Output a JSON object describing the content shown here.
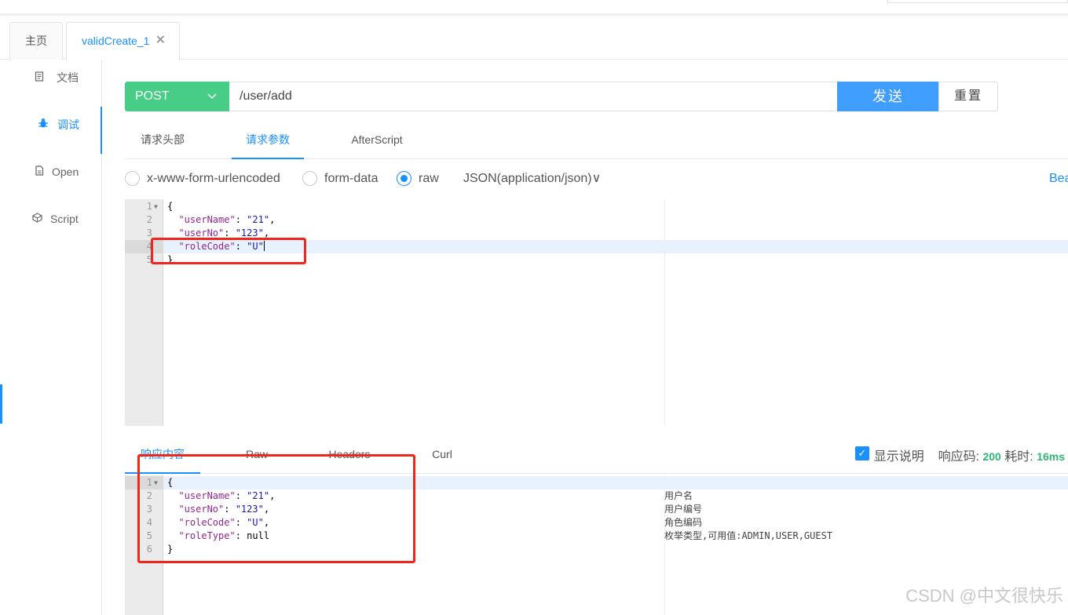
{
  "tabs": {
    "home": "主页",
    "active": "validCreate_1",
    "close_glyph": "✕"
  },
  "sidebar": {
    "items": [
      {
        "label": "文档",
        "icon": "document-icon"
      },
      {
        "label": "调试",
        "icon": "bug-icon"
      },
      {
        "label": "Open",
        "icon": "file-icon"
      },
      {
        "label": "Script",
        "icon": "code-icon"
      }
    ]
  },
  "request": {
    "method": "POST",
    "url": "/user/add",
    "send_label": "发送",
    "reset_label": "重置"
  },
  "req_tabs": [
    "请求头部",
    "请求参数",
    "AfterScript"
  ],
  "body_types": {
    "options": [
      "x-www-form-urlencoded",
      "form-data",
      "raw"
    ],
    "selected": "raw",
    "content_type": "JSON(application/json)∨",
    "beautify": "Beautify"
  },
  "request_body": [
    {
      "n": "1",
      "text": "{"
    },
    {
      "n": "2",
      "key": "\"userName\"",
      "val": "\"21\"",
      "tail": ","
    },
    {
      "n": "3",
      "key": "\"userNo\"",
      "val": "\"123\"",
      "tail": ","
    },
    {
      "n": "4",
      "key": "\"roleCode\"",
      "val": "\"U\"",
      "tail": ""
    },
    {
      "n": "5",
      "text": "}"
    }
  ],
  "resp_tabs": [
    "响应内容",
    "Raw",
    "Headers",
    "Curl"
  ],
  "resp_meta": {
    "show_desc": "显示说明",
    "code_label": "响应码:",
    "code": "200",
    "time_label": "耗时:",
    "time": "16ms"
  },
  "response_body": [
    {
      "n": "1",
      "text": "{"
    },
    {
      "n": "2",
      "key": "\"userName\"",
      "val": "\"21\"",
      "tail": ",",
      "desc": "用户名"
    },
    {
      "n": "3",
      "key": "\"userNo\"",
      "val": "\"123\"",
      "tail": ",",
      "desc": "用户编号"
    },
    {
      "n": "4",
      "key": "\"roleCode\"",
      "val": "\"U\"",
      "tail": ",",
      "desc": "角色编码"
    },
    {
      "n": "5",
      "key": "\"roleType\"",
      "val": "null",
      "tail": "",
      "desc": "枚举类型,可用值:ADMIN,USER,GUEST"
    },
    {
      "n": "6",
      "text": "}"
    }
  ],
  "watermark": "CSDN @中文很快乐"
}
